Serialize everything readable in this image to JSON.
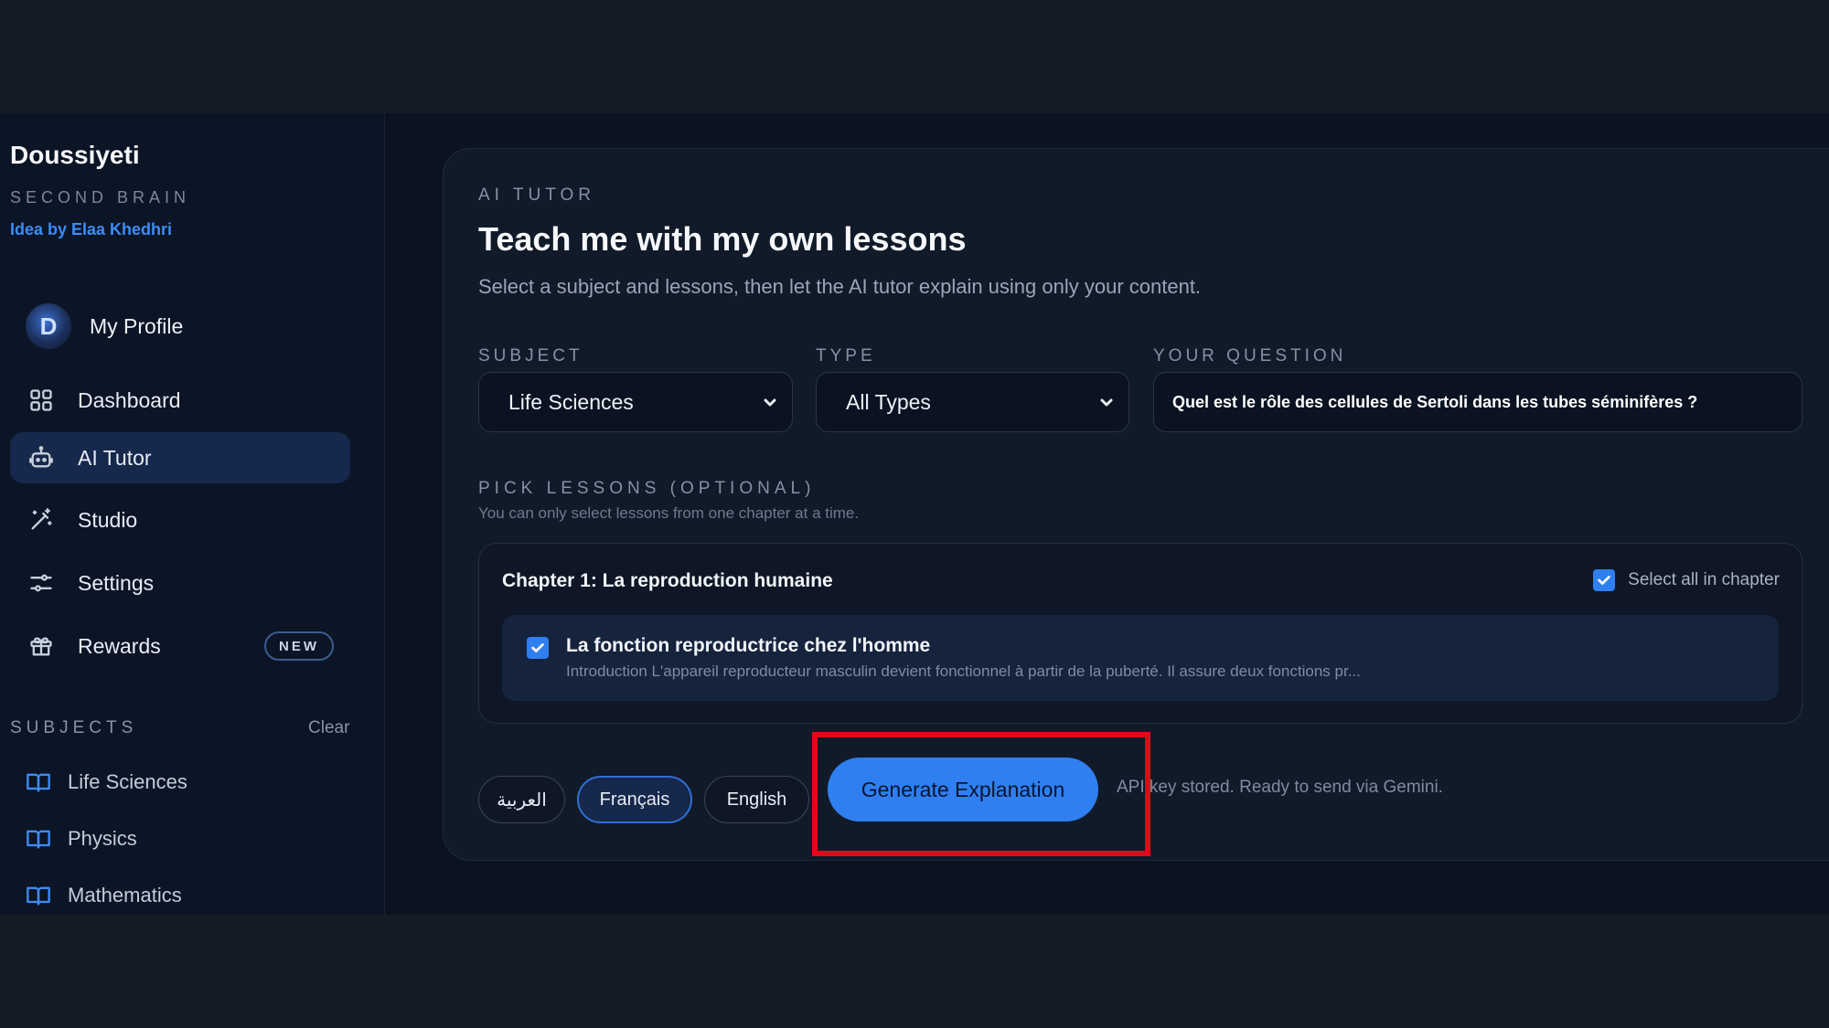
{
  "sidebar": {
    "brand_title": "Doussiyeti",
    "brand_subtitle": "SECOND BRAIN",
    "brand_credit": "Idea by Elaa Khedhri",
    "profile_label": "My Profile",
    "avatar_letter": "D",
    "nav": [
      {
        "label": "Dashboard",
        "icon": "grid-icon"
      },
      {
        "label": "AI Tutor",
        "icon": "robot-icon",
        "active": true
      },
      {
        "label": "Studio",
        "icon": "magic-wand-icon"
      },
      {
        "label": "Settings",
        "icon": "sliders-icon"
      },
      {
        "label": "Rewards",
        "icon": "gift-icon",
        "badge": "NEW"
      }
    ],
    "subjects_heading": "SUBJECTS",
    "clear_label": "Clear",
    "subjects": [
      "Life Sciences",
      "Physics",
      "Mathematics"
    ]
  },
  "main": {
    "eyebrow": "AI TUTOR",
    "title": "Teach me with my own lessons",
    "subtitle": "Select a subject and lessons, then let the AI tutor explain using only your content.",
    "subject_label": "SUBJECT",
    "subject_value": "Life Sciences",
    "type_label": "TYPE",
    "type_value": "All Types",
    "question_label": "YOUR QUESTION",
    "question_value": "Quel est le rôle des cellules de Sertoli dans les tubes séminifères ?",
    "pick_label": "PICK LESSONS (OPTIONAL)",
    "pick_hint": "You can only select lessons from one chapter at a time.",
    "chapter": {
      "title": "Chapter 1: La reproduction humaine",
      "select_all_label": "Select all in chapter",
      "lesson_title": "La fonction reproductrice chez l'homme",
      "lesson_desc": "Introduction L'appareil reproducteur masculin devient fonctionnel à partir de la puberté. Il assure deux fonctions pr..."
    },
    "languages": [
      "العربية",
      "Français",
      "English"
    ],
    "active_language": "Français",
    "generate_label": "Generate Explanation",
    "status_text": "API key stored. Ready to send via Gemini."
  },
  "colors": {
    "accent": "#2f7ff0",
    "highlight": "#e3071a",
    "background": "#0b1220"
  }
}
